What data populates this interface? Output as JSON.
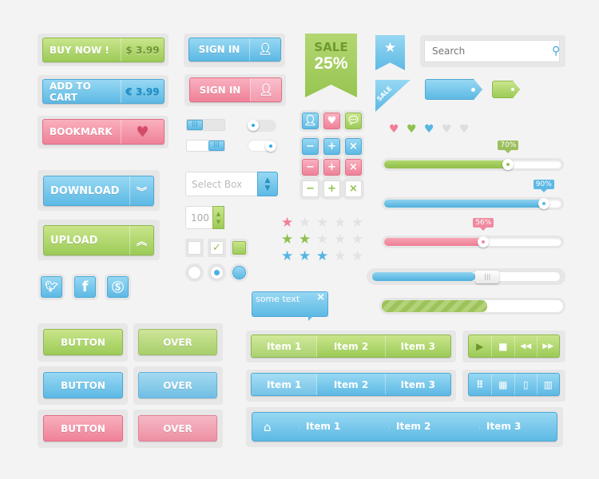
{
  "colors": {
    "green": "#9ccb58",
    "blue": "#5db9e4",
    "pink": "#ef8198",
    "background": "#f3f3f3"
  },
  "buy_now": {
    "label": "BUY NOW !",
    "price": "$ 3.99"
  },
  "add_to_cart": {
    "label": "ADD TO CART",
    "price": "€ 3.99"
  },
  "bookmark": {
    "label": "BOOKMARK",
    "icon": "heart-icon"
  },
  "sign_in_blue": {
    "label": "SIGN IN",
    "icon": "user-icon"
  },
  "sign_in_pink": {
    "label": "SIGN IN",
    "icon": "user-icon"
  },
  "download": {
    "label": "DOWNLOAD",
    "icon": "chevron-double-down-icon"
  },
  "upload": {
    "label": "UPLOAD",
    "icon": "chevron-double-up-icon"
  },
  "social": [
    "twitter-icon",
    "facebook-icon",
    "skype-icon"
  ],
  "button_rows": [
    {
      "normal": "BUTTON",
      "over": "OVER",
      "color": "green"
    },
    {
      "normal": "BUTTON",
      "over": "OVER",
      "color": "blue"
    },
    {
      "normal": "BUTTON",
      "over": "OVER",
      "color": "pink"
    }
  ],
  "select_box": {
    "placeholder": "Select Box"
  },
  "number_input": {
    "value": "100"
  },
  "sale_ribbon": {
    "top": "SALE",
    "bottom": "25%"
  },
  "sale_corner": "SALE",
  "search": {
    "placeholder": "Search"
  },
  "sliders": [
    {
      "value": 70,
      "label": "70%",
      "color": "green"
    },
    {
      "value": 90,
      "label": "90%",
      "color": "blue"
    },
    {
      "value": 56,
      "label": "56%",
      "color": "pink"
    }
  ],
  "ratings": [
    {
      "value": 1,
      "color": "pink"
    },
    {
      "value": 2,
      "color": "green"
    },
    {
      "value": 3,
      "color": "blue"
    }
  ],
  "hearts": [
    "pink",
    "green",
    "blue",
    "grey",
    "grey"
  ],
  "big_slider": {
    "value": 55
  },
  "progress": {
    "value": 58
  },
  "tooltip": {
    "text": "some text",
    "close": "×"
  },
  "segmented_green": [
    "Item 1",
    "Item 2",
    "Item 3"
  ],
  "segmented_blue": [
    "Item 1",
    "Item 2",
    "Item 3"
  ],
  "media_controls": [
    "play-icon",
    "stop-icon",
    "rewind-icon",
    "fast-forward-icon"
  ],
  "view_controls": [
    "grid-small-icon",
    "grid-large-icon",
    "carousel-icon",
    "columns-icon"
  ],
  "breadcrumb": [
    "Item 1",
    "Item 2",
    "Item 3"
  ]
}
